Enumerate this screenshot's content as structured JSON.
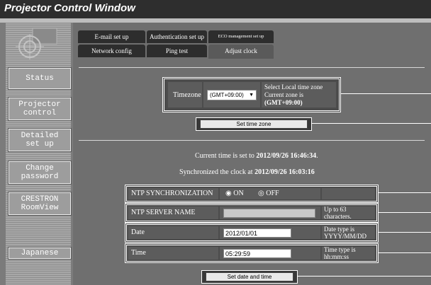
{
  "window": {
    "title": "Projector Control Window"
  },
  "sidebar": {
    "items": [
      {
        "label": "Status"
      },
      {
        "label": "Projector\ncontrol"
      },
      {
        "label": "Detailed\nset up"
      },
      {
        "label": "Change\npassword"
      },
      {
        "label": "CRESTRON\nRoomView"
      },
      {
        "label": "Japanese"
      }
    ]
  },
  "tabs": [
    {
      "label": "E-mail set up"
    },
    {
      "label": "Authentication set up"
    },
    {
      "label": "ECO management set up"
    },
    {
      "label": "Network config"
    },
    {
      "label": "Ping test"
    },
    {
      "label": "Adjust clock"
    }
  ],
  "timezone": {
    "label": "Timezone",
    "selected": "(GMT+09:00)",
    "info_line1": "Select Local time zone",
    "info_line2": "Current zone is",
    "current_zone": "(GMT+09:00)",
    "set_button": "Set time zone"
  },
  "status": {
    "current_prefix": "Current time is set to",
    "current_time": "2012/09/26 16:46:34",
    "current_suffix": ".",
    "sync_prefix": "Synchronized the clock at",
    "sync_time": "2012/09/26 16:03:16"
  },
  "ntp": {
    "sync_label": "NTP SYNCHRONIZATION",
    "on_label": "ON",
    "off_label": "OFF",
    "selected": "ON",
    "server_label": "NTP SERVER NAME",
    "server_value": "",
    "server_hint": "Up to 63\ncharacters."
  },
  "date": {
    "label": "Date",
    "value": "2012/01/01",
    "hint": "Date type is\nYYYY/MM/DD"
  },
  "time": {
    "label": "Time",
    "value": "05:29:59",
    "hint": "Time type is\nhh:mm:ss"
  },
  "set_datetime_button": "Set date and time"
}
